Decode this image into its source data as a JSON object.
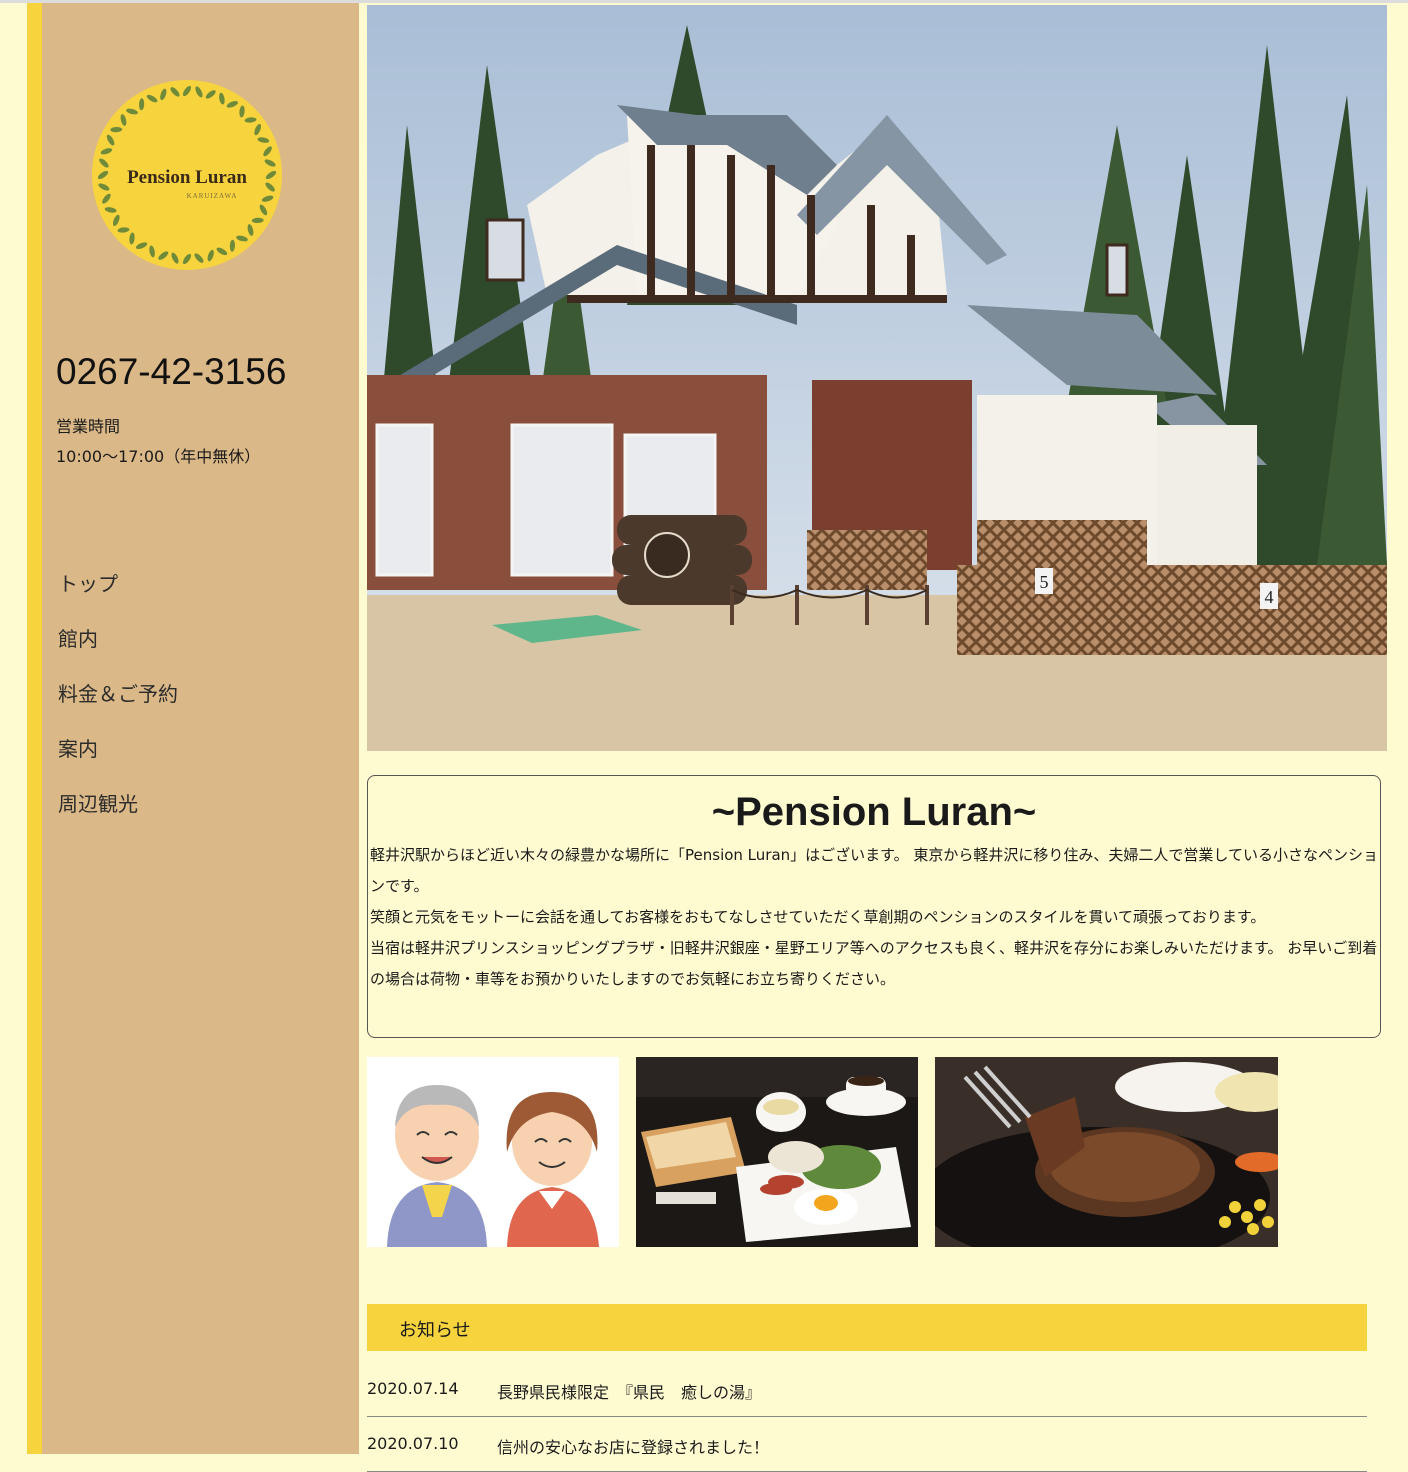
{
  "logo": {
    "name": "Pension Luran",
    "sub": "KARUIZAWA"
  },
  "contact": {
    "phone": "0267-42-3156",
    "hours_label": "営業時間",
    "hours_value": "10:00〜17:00（年中無休）"
  },
  "nav": {
    "items": [
      {
        "label": "トップ"
      },
      {
        "label": "館内"
      },
      {
        "label": "料金＆ご予約"
      },
      {
        "label": "案内"
      },
      {
        "label": "周辺観光"
      }
    ]
  },
  "intro": {
    "title": "~Pension Luran~",
    "paragraphs": [
      "軽井沢駅からほど近い木々の緑豊かな場所に「Pension Luran」はございます。 東京から軽井沢に移り住み、夫婦二人で営業している小さなペンションです。",
      "笑顔と元気をモットーに会話を通してお客様をおもてなしさせていただく草創期のペンションのスタイルを貫いて頑張っております。",
      "当宿は軽井沢プリンスショッピングプラザ・旧軽井沢銀座・星野エリア等へのアクセスも良く、軽井沢を存分にお楽しみいただけます。 お早いご到着の場合は荷物・車等をお預かりいたしますのでお気軽にお立ち寄りください。"
    ]
  },
  "news": {
    "header": "お知らせ",
    "items": [
      {
        "date": "2020.07.14",
        "title": "長野県民様限定　『県民　癒しの湯』"
      },
      {
        "date": "2020.07.10",
        "title": "信州の安心なお店に登録されました！"
      }
    ]
  },
  "colors": {
    "page_bg": "#fffbd1",
    "sidebar_bg": "#dbb887",
    "accent_yellow": "#f7d43e"
  }
}
